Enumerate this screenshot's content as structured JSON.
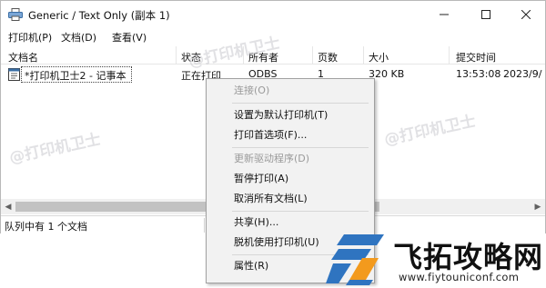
{
  "window": {
    "title": "Generic / Text Only (副本 1)"
  },
  "menubar": {
    "items": [
      "打印机(P)",
      "文档(D)",
      "查看(V)"
    ]
  },
  "columns": [
    "文档名",
    "状态",
    "所有者",
    "页数",
    "大小",
    "提交时间"
  ],
  "job": {
    "name": "*打印机卫士2 - 记事本",
    "status": "正在打印",
    "owner": "ODBS",
    "pages": "1",
    "size": "320 KB",
    "time": "13:53:08",
    "date": "2023/9/"
  },
  "statusbar": {
    "text": "队列中有 1 个文档"
  },
  "watermark": {
    "text": "@打印机卫士"
  },
  "context_menu": {
    "items": [
      {
        "label": "连接(O)",
        "disabled": true
      },
      {
        "label": "设置为默认打印机(T)",
        "disabled": false
      },
      {
        "label": "打印首选项(F)...",
        "disabled": false
      },
      {
        "label": "更新驱动程序(D)",
        "disabled": true
      },
      {
        "label": "暂停打印(A)",
        "disabled": false
      },
      {
        "label": "取消所有文档(L)",
        "disabled": false
      },
      {
        "label": "共享(H)...",
        "disabled": false
      },
      {
        "label": "脱机使用打印机(U)",
        "disabled": false
      },
      {
        "label": "属性(R)",
        "disabled": false
      }
    ]
  },
  "brand": {
    "name": "飞拓攻略网",
    "url": "www.fiytouniconf.com"
  },
  "colors": {
    "brand_blue": "#2f74c0",
    "brand_orange": "#f39a1d"
  }
}
